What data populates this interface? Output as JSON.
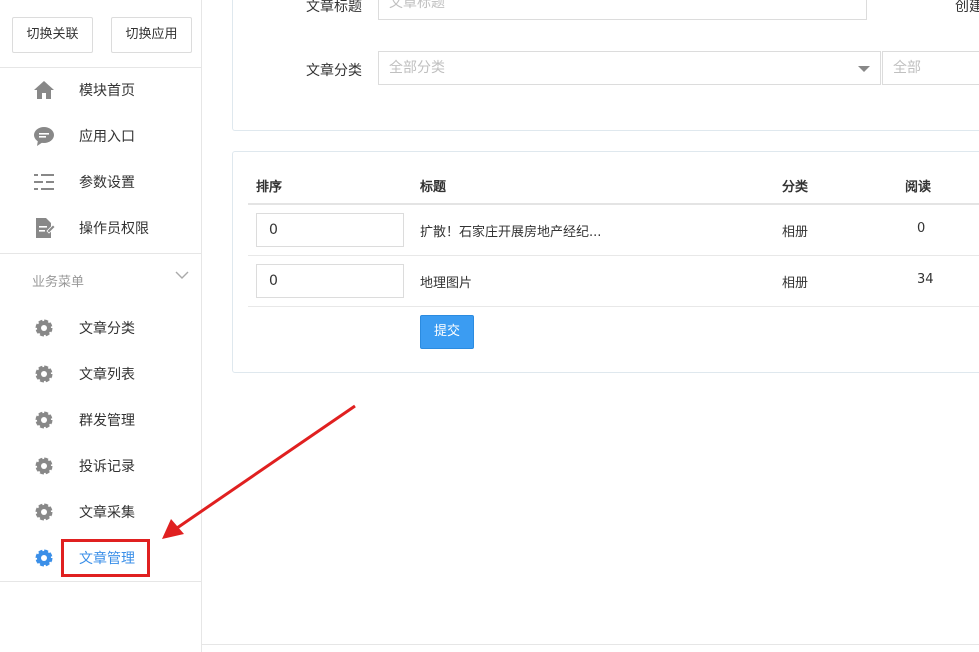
{
  "sidebar": {
    "switch_relation": "切换关联",
    "switch_app": "切换应用",
    "items": [
      {
        "label": "模块首页",
        "icon": "home-icon"
      },
      {
        "label": "应用入口",
        "icon": "chat-bubble-icon"
      },
      {
        "label": "参数设置",
        "icon": "list-settings-icon"
      },
      {
        "label": "操作员权限",
        "icon": "document-edit-icon"
      }
    ],
    "group_title": "业务菜单",
    "business_items": [
      {
        "label": "文章分类",
        "icon": "gear-icon"
      },
      {
        "label": "文章列表",
        "icon": "gear-icon"
      },
      {
        "label": "群发管理",
        "icon": "gear-icon"
      },
      {
        "label": "投诉记录",
        "icon": "gear-icon"
      },
      {
        "label": "文章采集",
        "icon": "gear-icon"
      },
      {
        "label": "文章管理",
        "icon": "gear-icon",
        "active": true
      }
    ]
  },
  "filter": {
    "title_label": "文章标题",
    "title_placeholder": "文章标题",
    "created_label_partial": "创建",
    "category_label": "文章分类",
    "category_value": "全部分类",
    "second_select_value": "全部"
  },
  "table": {
    "headers": {
      "sort": "排序",
      "title": "标题",
      "category": "分类",
      "reads": "阅读"
    },
    "rows": [
      {
        "sort": "0",
        "title": "扩散！石家庄开展房地产经纪...",
        "category": "相册",
        "reads": "0"
      },
      {
        "sort": "0",
        "title": "地理图片",
        "category": "相册",
        "reads": "34"
      }
    ],
    "submit_label": "提交"
  },
  "colors": {
    "accent": "#3b9cf2",
    "highlight": "#e02020",
    "active_text": "#3b8fe8"
  }
}
